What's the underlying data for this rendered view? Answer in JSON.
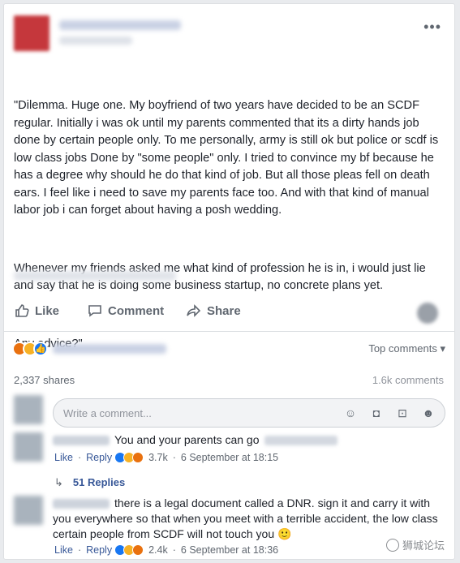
{
  "post": {
    "more_icon": "more-dots-icon",
    "paragraphs": [
      "\"Dilemma. Huge one. My boyfriend of two years have decided to be an SCDF regular. Initially i was ok until my parents commented that its a dirty hands job done by certain people only. To me personally, army is still ok but police or scdf is low class jobs Done by \"some people\" only. I tried to convince my bf because he has a degree why should he do that kind of job. But all those pleas fell on death ears. I feel like i need to save my parents face too. And with that kind of manual labor job i can forget about having a posh wedding.",
      "Whenever my friends asked me what kind of profession he is in, i would just lie and say that he is doing some business startup, no concrete plans yet.",
      "Any advice?\""
    ]
  },
  "actions": {
    "like": "Like",
    "comment": "Comment",
    "share": "Share"
  },
  "reactions": {
    "top_comments": "Top comments ▾"
  },
  "stats": {
    "shares": "2,337 shares",
    "comments": "1.6k comments"
  },
  "compose": {
    "placeholder": "Write a comment..."
  },
  "comments": [
    {
      "text": "You and your parents can go",
      "like": "Like",
      "reply": "Reply",
      "reaction_count": "3.7k",
      "time": "6 September at 18:15"
    },
    {
      "text": "there is a legal document called a DNR. sign it and carry it with you everywhere so that when you meet with a terrible accident, the low class certain people from SCDF will not touch you 🙂",
      "like": "Like",
      "reply": "Reply",
      "reaction_count": "2.4k",
      "time": "6 September at 18:36"
    }
  ],
  "replies": {
    "label": "51 Replies"
  },
  "watermark": {
    "text": "狮城论坛"
  },
  "colors": {
    "link": "#385898",
    "muted": "#606770",
    "like_blue": "#1877f2",
    "angry_orange": "#e9710f",
    "haha_yellow": "#f7b125"
  }
}
